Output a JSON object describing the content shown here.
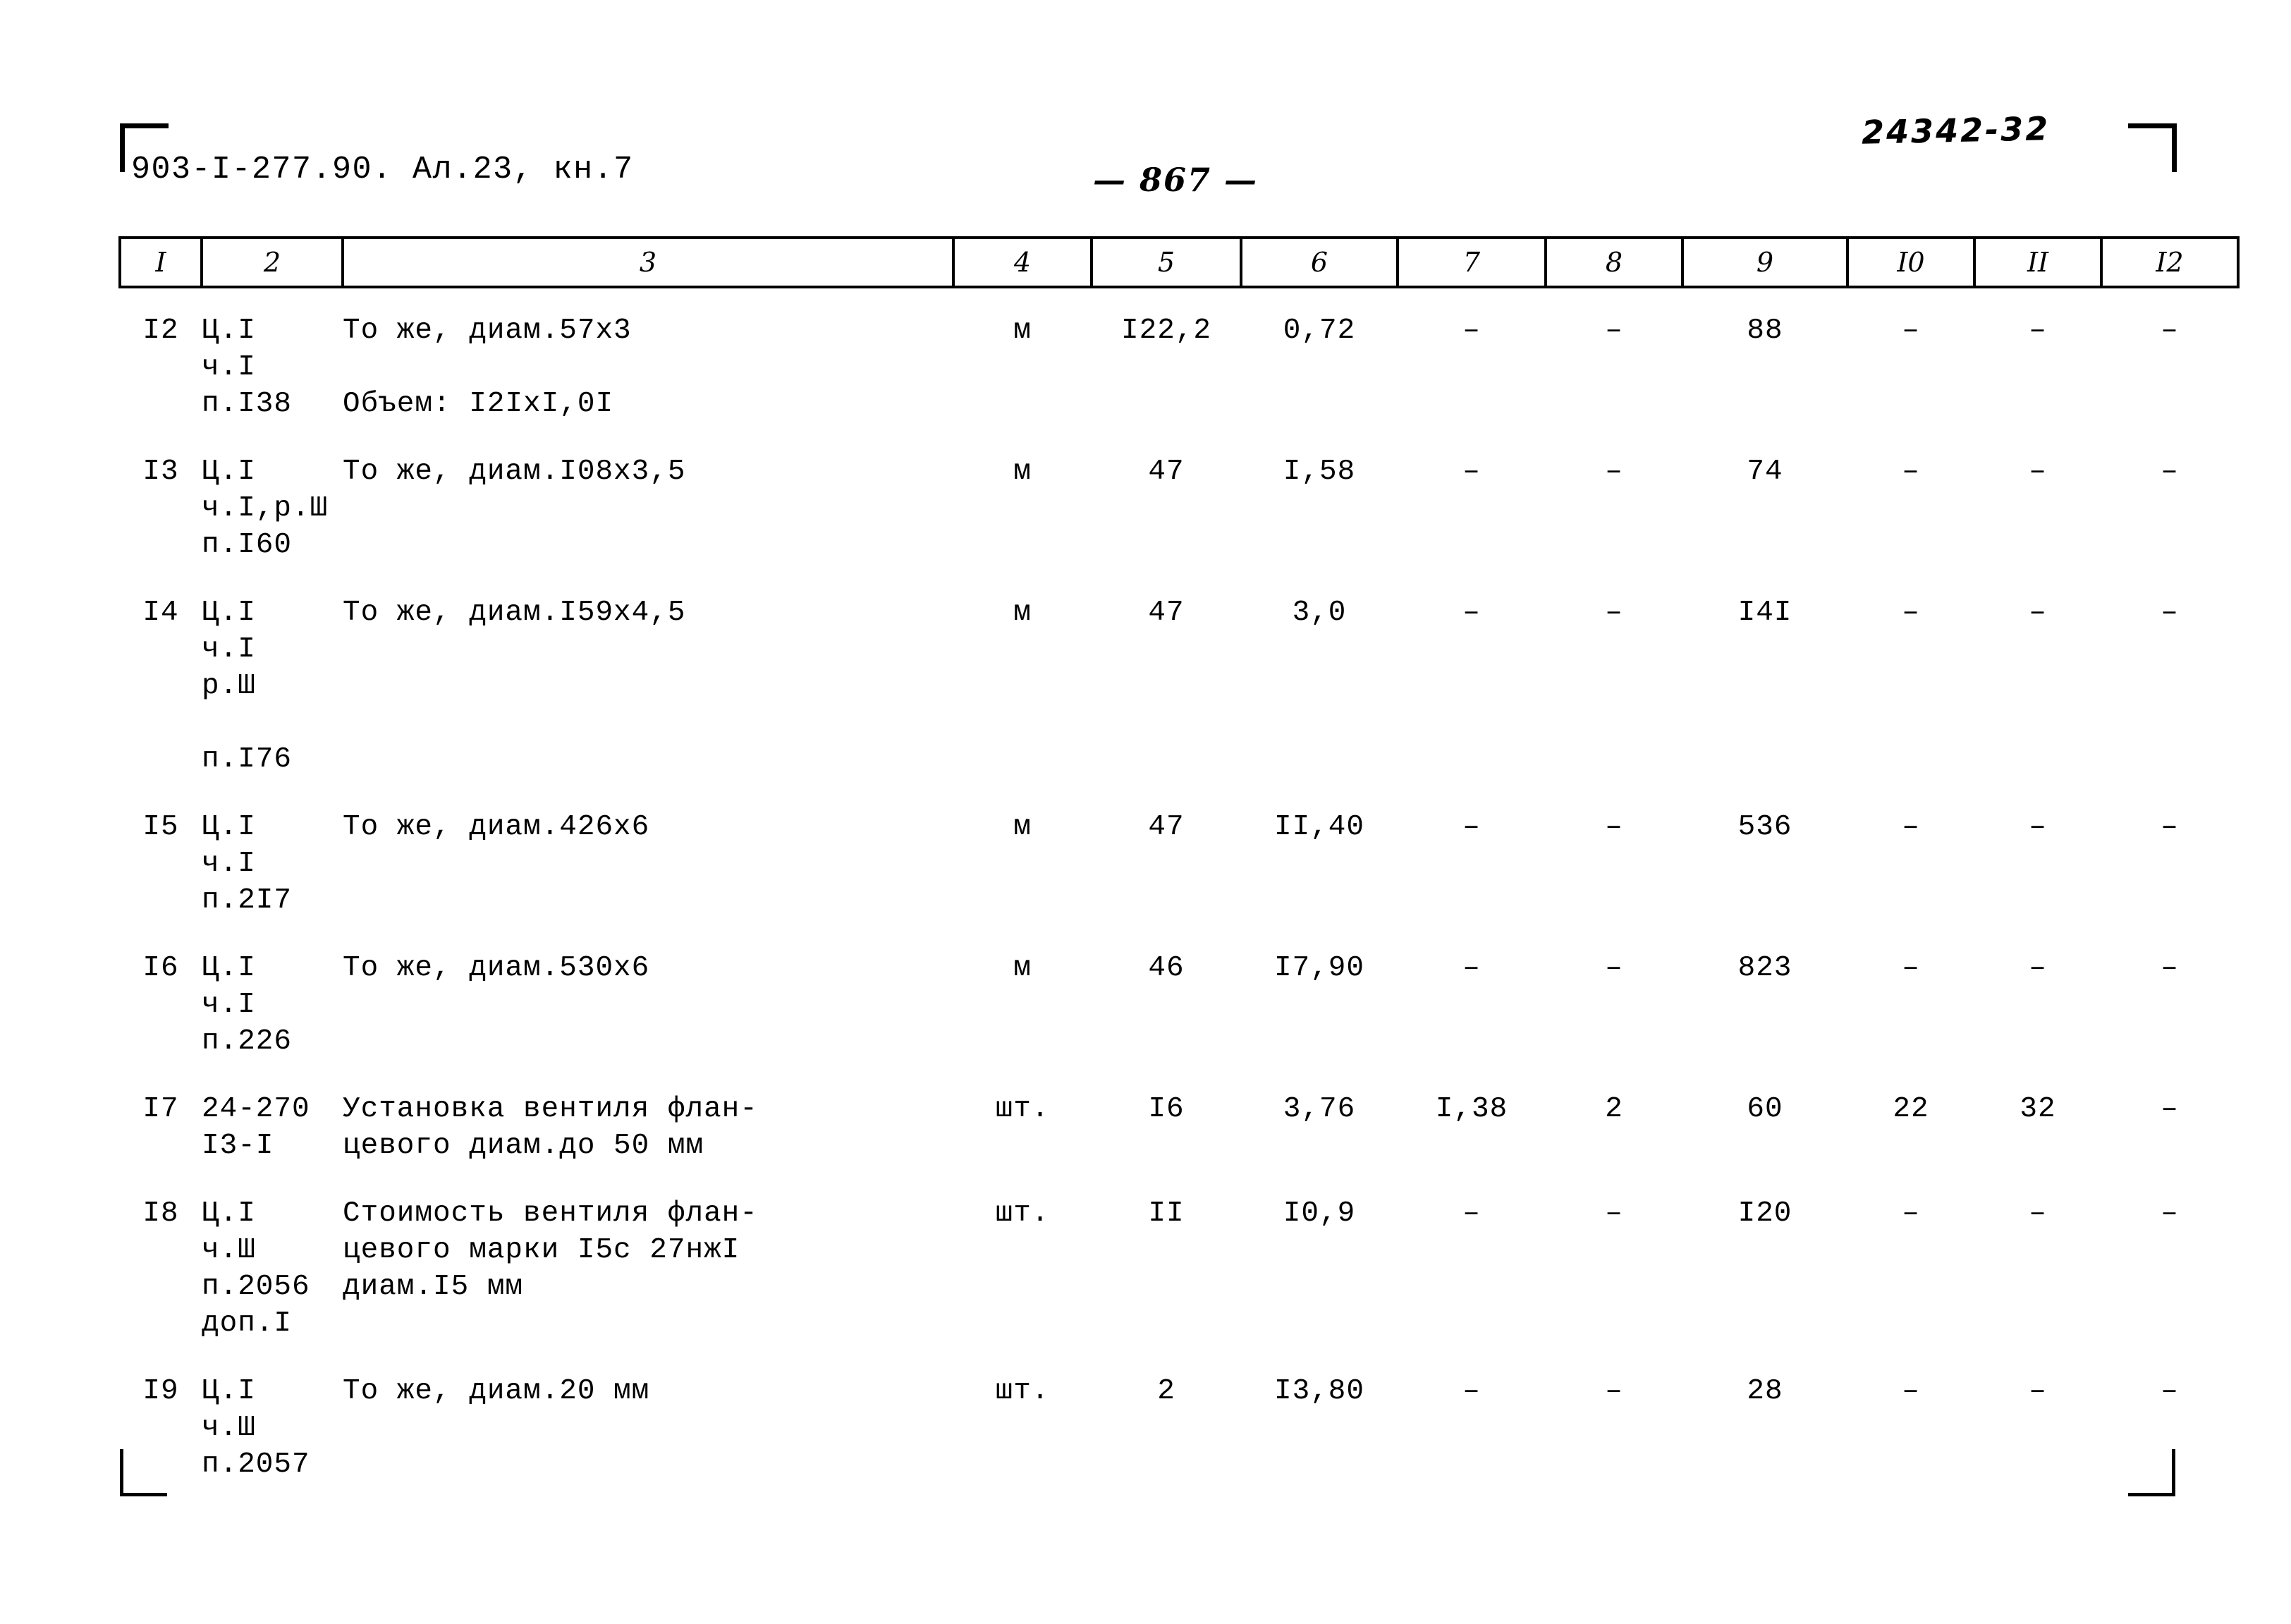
{
  "header": {
    "doc_code": "903-I-277.90. Ал.23, кн.7",
    "archive_number": "24342-32",
    "page_number": "— 867 —"
  },
  "table": {
    "column_headers": [
      "I",
      "2",
      "3",
      "4",
      "5",
      "6",
      "7",
      "8",
      "9",
      "I0",
      "II",
      "I2"
    ],
    "rows": [
      {
        "num": "I2",
        "code": "Ц.I\nч.I\nп.I38",
        "desc": "То же, диам.57х3\n\nОбъем: I2IхI,0I",
        "unit": "м",
        "c5": "I22,2",
        "c6": "0,72",
        "c7": "–",
        "c8": "–",
        "c9": "88",
        "c10": "–",
        "c11": "–",
        "c12": "–",
        "shift": "shift-1"
      },
      {
        "num": "I3",
        "code": "Ц.I\nч.I,р.Ш\nп.I60",
        "desc": "То же, диам.I08х3,5",
        "unit": "м",
        "c5": "47",
        "c6": "I,58",
        "c7": "–",
        "c8": "–",
        "c9": "74",
        "c10": "–",
        "c11": "–",
        "c12": "–",
        "shift": "shift-1"
      },
      {
        "num": "I4",
        "code": "Ц.I\nч.I\nр.Ш\n\nп.I76",
        "desc": "То же, диам.I59х4,5",
        "unit": "м",
        "c5": "47",
        "c6": "3,0",
        "c7": "–",
        "c8": "–",
        "c9": "I4I",
        "c10": "–",
        "c11": "–",
        "c12": "–",
        "shift": "shift-1"
      },
      {
        "num": "I5",
        "code": "Ц.I\nч.I\nп.2I7",
        "desc": "То же, диам.426х6",
        "unit": "м",
        "c5": "47",
        "c6": "II,40",
        "c7": "–",
        "c8": "–",
        "c9": "536",
        "c10": "–",
        "c11": "–",
        "c12": "–",
        "shift": "shift-1"
      },
      {
        "num": "I6",
        "code": "Ц.I\nч.I\nп.226",
        "desc": "То же, диам.530х6",
        "unit": "м",
        "c5": "46",
        "c6": "I7,90",
        "c7": "–",
        "c8": "–",
        "c9": "823",
        "c10": "–",
        "c11": "–",
        "c12": "–",
        "shift": "shift-1"
      },
      {
        "num": "I7",
        "code": "24-270\nI3-I",
        "desc": "Установка вентиля флан-\nцевого диам.до 50 мм",
        "unit": "шт.",
        "c5": "I6",
        "c6": "3,76",
        "c7": "I,38",
        "c8": "2",
        "c9": "60",
        "c10": "22",
        "c11": "32",
        "c12": "–",
        "shift": "shift-2"
      },
      {
        "num": "I8",
        "code": "Ц.I\nч.Ш\nп.2056\nдоп.I",
        "desc": "Стоимость вентиля флан-\nцевого марки I5с 27нжI\nдиам.I5 мм",
        "unit": "шт.",
        "c5": "II",
        "c6": "I0,9",
        "c7": "–",
        "c8": "–",
        "c9": "I20",
        "c10": "–",
        "c11": "–",
        "c12": "–",
        "shift": "shift-3"
      },
      {
        "num": "I9",
        "code": "Ц.I\nч.Ш\nп.2057",
        "desc": "То же, диам.20 мм",
        "unit": "шт.",
        "c5": "2",
        "c6": "I3,80",
        "c7": "–",
        "c8": "–",
        "c9": "28",
        "c10": "–",
        "c11": "–",
        "c12": "–",
        "shift": "shift-1"
      }
    ]
  }
}
